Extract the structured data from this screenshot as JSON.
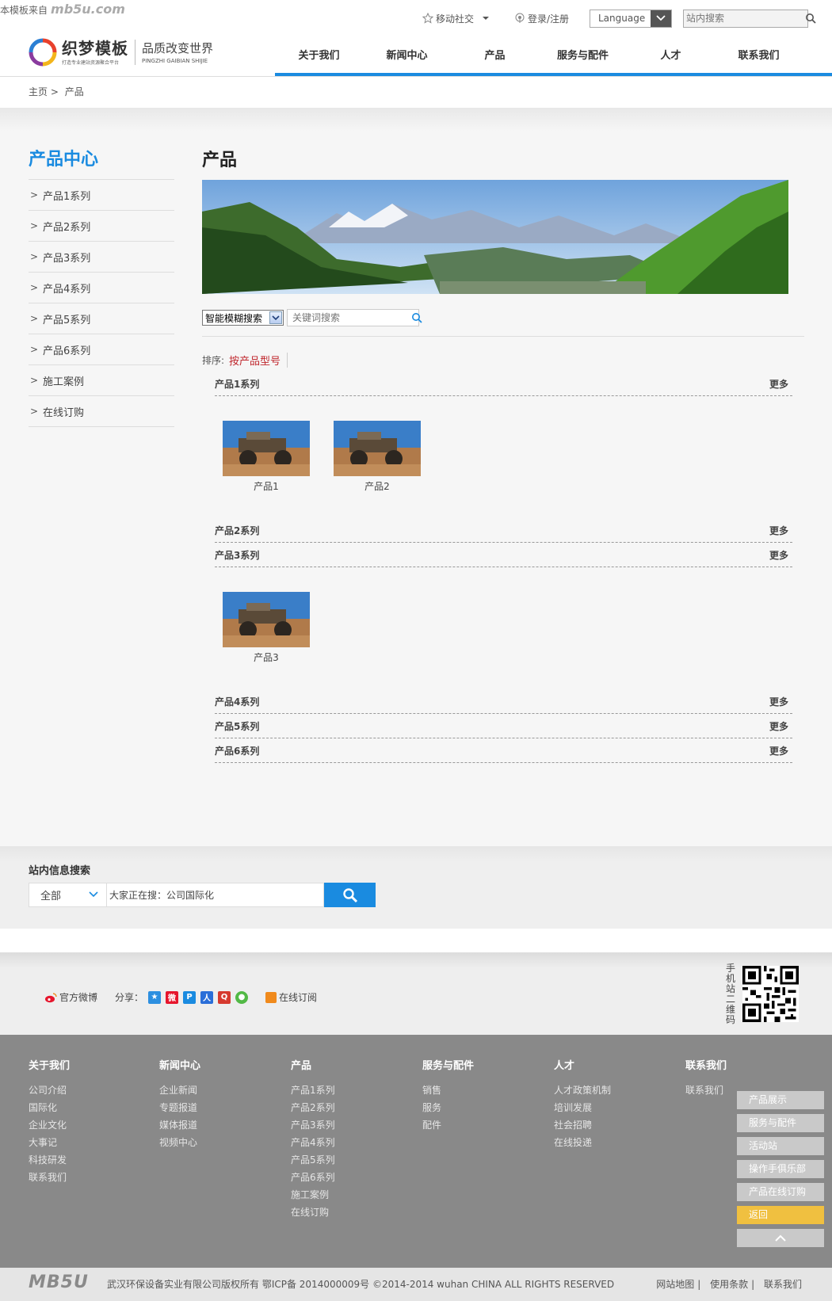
{
  "watermark": {
    "text": "本模板来自",
    "brand": "mb5u.com"
  },
  "util": {
    "mobile_social": "移动社交",
    "login": "登录/注册",
    "language": "Language",
    "search_placeholder": "站内搜索"
  },
  "logo": {
    "name": "织梦模板",
    "sub": "打造专业建站资源聚合平台",
    "slogan_cn": "品质改变世界",
    "slogan_en": "PINGZHI GAIBIAN SHIJIE"
  },
  "nav": [
    "关于我们",
    "新闻中心",
    "产品",
    "服务与配件",
    "人才",
    "联系我们"
  ],
  "breadcrumb": {
    "home": "主页",
    "sep": ">",
    "current": "产品"
  },
  "sidebar": {
    "title": "产品中心",
    "items": [
      "产品1系列",
      "产品2系列",
      "产品3系列",
      "产品4系列",
      "产品5系列",
      "产品6系列",
      "施工案例",
      "在线订购"
    ]
  },
  "main": {
    "title": "产品",
    "search_mode": "智能模糊搜索",
    "keyword_placeholder": "关键词搜索",
    "sort_label": "排序:",
    "sort_active": "按产品型号",
    "more_label": "更多",
    "series": [
      {
        "name": "产品1系列",
        "products": [
          "产品1",
          "产品2"
        ]
      },
      {
        "name": "产品2系列",
        "products": []
      },
      {
        "name": "产品3系列",
        "products": [
          "产品3"
        ]
      },
      {
        "name": "产品4系列",
        "products": []
      },
      {
        "name": "产品5系列",
        "products": []
      },
      {
        "name": "产品6系列",
        "products": []
      }
    ]
  },
  "info_search": {
    "title": "站内信息搜索",
    "scope": "全部",
    "query": "大家正在搜：公司国际化"
  },
  "social": {
    "weibo": "官方微博",
    "share_label": "分享：",
    "rss": "在线订阅",
    "qr_label": "手机站二维码"
  },
  "footer": {
    "columns": [
      {
        "title": "关于我们",
        "links": [
          "公司介绍",
          "国际化",
          "企业文化",
          "大事记",
          "科技研发",
          "联系我们"
        ]
      },
      {
        "title": "新闻中心",
        "links": [
          "企业新闻",
          "专题报道",
          "媒体报道",
          "视频中心"
        ]
      },
      {
        "title": "产品",
        "links": [
          "产品1系列",
          "产品2系列",
          "产品3系列",
          "产品4系列",
          "产品5系列",
          "产品6系列",
          "施工案例",
          "在线订购"
        ]
      },
      {
        "title": "服务与配件",
        "links": [
          "销售",
          "服务",
          "配件"
        ]
      },
      {
        "title": "人才",
        "links": [
          "人才政策机制",
          "培训发展",
          "社会招聘",
          "在线投递"
        ]
      },
      {
        "title": "联系我们",
        "links": [
          "联系我们"
        ]
      }
    ],
    "quick_links": [
      "产品展示",
      "服务与配件",
      "活动站",
      "操作手俱乐部",
      "产品在线订购",
      "返回"
    ]
  },
  "bottom": {
    "logo": "MB5U",
    "copyright": "武汉环保设备实业有限公司版权所有 鄂ICP备 2014000009号 ©2014-2014 wuhan CHINA ALL RIGHTS RESERVED",
    "links": [
      "网站地图",
      "使用条款",
      "联系我们"
    ]
  },
  "colors": {
    "accent": "#1a8be0",
    "sort_active": "#c0272d",
    "back_button": "#f0c040",
    "footer_bg": "#898989"
  }
}
